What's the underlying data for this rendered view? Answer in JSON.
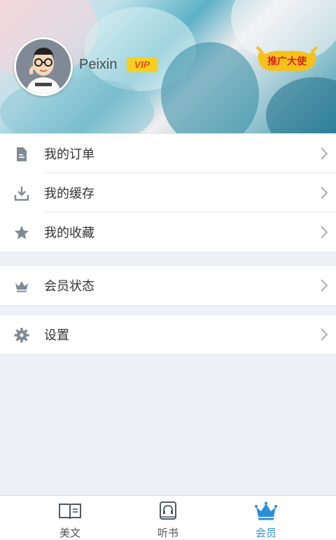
{
  "profile": {
    "username": "Peixin",
    "vip_badge": "VIP",
    "ambassador_badge": "推广大使"
  },
  "menu_group_1": [
    {
      "label": "我的订单",
      "icon": "document-icon"
    },
    {
      "label": "我的缓存",
      "icon": "download-icon"
    },
    {
      "label": "我的收藏",
      "icon": "star-icon"
    }
  ],
  "menu_group_2": [
    {
      "label": "会员状态",
      "icon": "crown-icon"
    }
  ],
  "menu_group_3": [
    {
      "label": "设置",
      "icon": "gear-icon"
    }
  ],
  "tabs": [
    {
      "label": "美文",
      "icon": "book-icon",
      "active": false
    },
    {
      "label": "听书",
      "icon": "headphone-book-icon",
      "active": false
    },
    {
      "label": "会员",
      "icon": "crown-icon",
      "active": true
    }
  ],
  "colors": {
    "accent": "#2b8fd8",
    "icon_gray": "#7f8a96",
    "vip_bg": "#f6cf1f",
    "vip_text": "#e8531f"
  }
}
